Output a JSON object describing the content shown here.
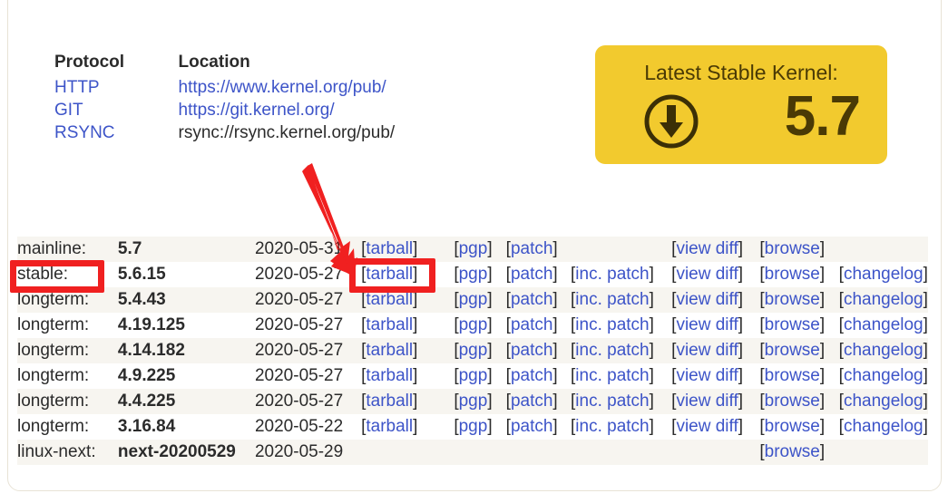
{
  "mirrors": {
    "headers": {
      "protocol": "Protocol",
      "location": "Location"
    },
    "rows": [
      {
        "protocol": "HTTP",
        "location": "https://www.kernel.org/pub/",
        "is_link": true
      },
      {
        "protocol": "GIT",
        "location": "https://git.kernel.org/",
        "is_link": true
      },
      {
        "protocol": "RSYNC",
        "location": "rsync://rsync.kernel.org/pub/",
        "is_link": false
      }
    ]
  },
  "latest_stable": {
    "title": "Latest Stable Kernel:",
    "version": "5.7",
    "icon": "download-circle-icon",
    "background_color": "#f2ca2e",
    "text_color": "#4a3a05"
  },
  "releases": {
    "link_labels": {
      "tarball": "tarball",
      "pgp": "pgp",
      "patch": "patch",
      "inc_patch": "inc. patch",
      "view_diff": "view diff",
      "browse": "browse",
      "changelog": "changelog"
    },
    "rows": [
      {
        "kind": "mainline:",
        "version": "5.7",
        "date": "2020-05-31",
        "links": [
          "tarball",
          "pgp",
          "patch",
          "view diff",
          "browse"
        ]
      },
      {
        "kind": "stable:",
        "version": "5.6.15",
        "date": "2020-05-27",
        "links": [
          "tarball",
          "pgp",
          "patch",
          "inc. patch",
          "view diff",
          "browse",
          "changelog"
        ]
      },
      {
        "kind": "longterm:",
        "version": "5.4.43",
        "date": "2020-05-27",
        "links": [
          "tarball",
          "pgp",
          "patch",
          "inc. patch",
          "view diff",
          "browse",
          "changelog"
        ]
      },
      {
        "kind": "longterm:",
        "version": "4.19.125",
        "date": "2020-05-27",
        "links": [
          "tarball",
          "pgp",
          "patch",
          "inc. patch",
          "view diff",
          "browse",
          "changelog"
        ]
      },
      {
        "kind": "longterm:",
        "version": "4.14.182",
        "date": "2020-05-27",
        "links": [
          "tarball",
          "pgp",
          "patch",
          "inc. patch",
          "view diff",
          "browse",
          "changelog"
        ]
      },
      {
        "kind": "longterm:",
        "version": "4.9.225",
        "date": "2020-05-27",
        "links": [
          "tarball",
          "pgp",
          "patch",
          "inc. patch",
          "view diff",
          "browse",
          "changelog"
        ]
      },
      {
        "kind": "longterm:",
        "version": "4.4.225",
        "date": "2020-05-27",
        "links": [
          "tarball",
          "pgp",
          "patch",
          "inc. patch",
          "view diff",
          "browse",
          "changelog"
        ]
      },
      {
        "kind": "longterm:",
        "version": "3.16.84",
        "date": "2020-05-22",
        "links": [
          "tarball",
          "pgp",
          "patch",
          "inc. patch",
          "view diff",
          "browse",
          "changelog"
        ]
      },
      {
        "kind": "linux-next:",
        "version": "next-20200529",
        "date": "2020-05-29",
        "links": [
          "browse"
        ]
      }
    ]
  },
  "annotations": {
    "color": "#f02020",
    "boxes": [
      {
        "target": "stable-row-label"
      },
      {
        "target": "stable-row-tarball-link"
      }
    ],
    "arrow": {
      "from": "mirror-location-area",
      "to": "stable-row-tarball-link"
    }
  },
  "colors": {
    "link": "#3d54c8",
    "text": "#2b2b2b",
    "row_alt": "#f7f5f0",
    "annotation": "#f02020",
    "badge": "#f2ca2e"
  }
}
